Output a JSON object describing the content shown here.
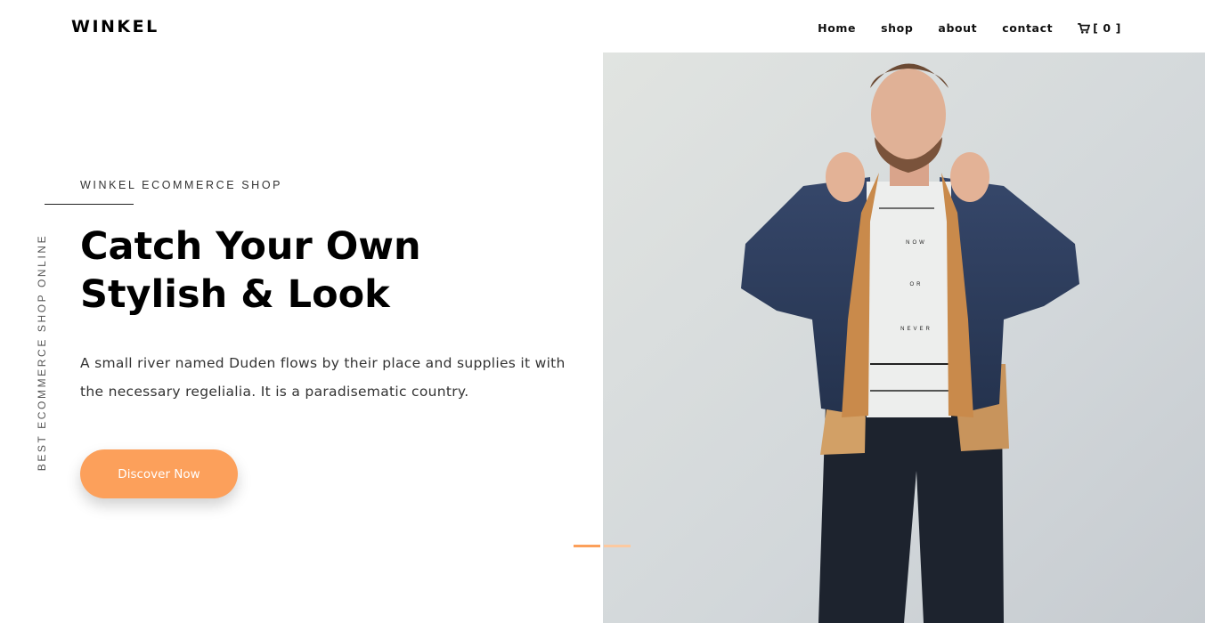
{
  "brand": "WINKEL",
  "nav": {
    "items": [
      "Home",
      "shop",
      "about",
      "contact"
    ],
    "cart_label": "[ 0 ]"
  },
  "hero": {
    "vertical_text": "BEST ECOMMERCE SHOP ONLINE",
    "subheading": "WINKEL ECOMMERCE SHOP",
    "heading": "Catch Your Own Stylish & Look",
    "description": "A small river named Duden flows by their place and supplies it with the necessary regelialia. It is a paradisematic country.",
    "cta_label": "Discover Now",
    "shirt_text": [
      "NOW",
      "OR",
      "NEVER"
    ]
  },
  "colors": {
    "accent": "#fca05b",
    "accent_light": "#fcc9a0",
    "text": "#000000",
    "muted": "#555555",
    "photo_bg": "#d6dade"
  },
  "icons": {
    "cart": "cart-icon"
  }
}
